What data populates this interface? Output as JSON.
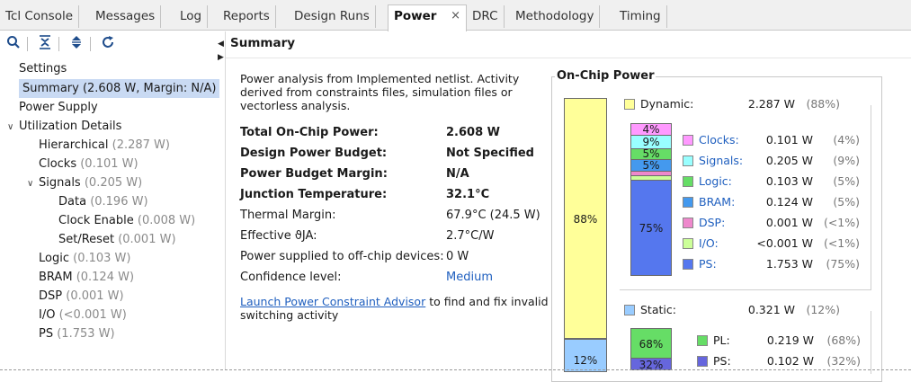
{
  "tabs": [
    {
      "label": "Tcl Console"
    },
    {
      "label": "Messages"
    },
    {
      "label": "Log"
    },
    {
      "label": "Reports"
    },
    {
      "label": "Design Runs"
    },
    {
      "label": "Power",
      "active": true
    },
    {
      "label": "DRC"
    },
    {
      "label": "Methodology"
    },
    {
      "label": "Timing"
    }
  ],
  "close_glyph": "×",
  "toolbar": {
    "icons": [
      "search-icon",
      "collapse-all-icon",
      "expand-all-icon",
      "refresh-icon"
    ]
  },
  "tree": {
    "settings": "Settings",
    "summary": "Summary (2.608 W, Margin: N/A)",
    "power_supply": "Power Supply",
    "utilization": "Utilization Details",
    "hierarchical": {
      "label": "Hierarchical",
      "value": "(2.287 W)"
    },
    "clocks": {
      "label": "Clocks",
      "value": "(0.101 W)"
    },
    "signals": {
      "label": "Signals",
      "value": "(0.205 W)"
    },
    "data": {
      "label": "Data",
      "value": "(0.196 W)"
    },
    "clock_enable": {
      "label": "Clock Enable",
      "value": "(0.008 W)"
    },
    "set_reset": {
      "label": "Set/Reset",
      "value": "(0.001 W)"
    },
    "logic": {
      "label": "Logic",
      "value": "(0.103 W)"
    },
    "bram": {
      "label": "BRAM",
      "value": "(0.124 W)"
    },
    "dsp": {
      "label": "DSP",
      "value": "(0.001 W)"
    },
    "io": {
      "label": "I/O",
      "value": "(<0.001 W)"
    },
    "ps": {
      "label": "PS",
      "value": "(1.753 W)"
    }
  },
  "summary": {
    "header": "Summary",
    "intro": "Power analysis from Implemented netlist. Activity derived from constraints files, simulation files or vectorless analysis.",
    "rows": {
      "total": {
        "k": "Total On-Chip Power:",
        "v": "2.608 W"
      },
      "budget": {
        "k": "Design Power Budget:",
        "v": "Not Specified"
      },
      "margin": {
        "k": "Power Budget Margin:",
        "v": "N/A"
      },
      "junction": {
        "k": "Junction Temperature:",
        "v": "32.1°C"
      },
      "thermal": {
        "k": "Thermal Margin:",
        "v": "67.9°C (24.5 W)"
      },
      "theta": {
        "k": "Effective ϑJA:",
        "v": "2.7°C/W"
      },
      "offchip": {
        "k": "Power supplied to off-chip devices:",
        "v": "0 W"
      },
      "confidence": {
        "k": "Confidence level:",
        "v": "Medium"
      }
    },
    "advisor_link": "Launch Power Constraint Advisor",
    "advisor_rest": " to find and fix invalid switching activity"
  },
  "on_chip": {
    "title": "On-Chip Power",
    "dynamic": {
      "label": "Dynamic:",
      "value": "2.287 W",
      "pct": "(88%)",
      "color": "#ffff99"
    },
    "static": {
      "label": "Static:",
      "value": "0.321 W",
      "pct": "(12%)",
      "color": "#99ccff"
    },
    "main_bar": {
      "dynamic_pct": 88,
      "dynamic_label": "88%",
      "static_pct": 12,
      "static_label": "12%"
    },
    "dynamic_items": [
      {
        "name": "Clocks:",
        "value": "0.101 W",
        "pct": "(4%)",
        "bar_label": "4%",
        "color": "#ff99ff",
        "link": true
      },
      {
        "name": "Signals:",
        "value": "0.205 W",
        "pct": "(9%)",
        "bar_label": "9%",
        "color": "#99ffff",
        "link": true
      },
      {
        "name": "Logic:",
        "value": "0.103 W",
        "pct": "(5%)",
        "bar_label": "5%",
        "color": "#66dd66",
        "link": true
      },
      {
        "name": "BRAM:",
        "value": "0.124 W",
        "pct": "(5%)",
        "bar_label": "5%",
        "color": "#4499ee",
        "link": true
      },
      {
        "name": "DSP:",
        "value": "0.001 W",
        "pct": "(<1%)",
        "bar_label": "",
        "color": "#ee88cc",
        "link": true
      },
      {
        "name": "I/O:",
        "value": "<0.001 W",
        "pct": "(<1%)",
        "bar_label": "",
        "color": "#ccff99",
        "link": true
      },
      {
        "name": "PS:",
        "value": "1.753 W",
        "pct": "(75%)",
        "bar_label": "75%",
        "color": "#5577ee",
        "link": true
      }
    ],
    "static_items": [
      {
        "name": "PL:",
        "value": "0.219 W",
        "pct": "(68%)",
        "bar_label": "68%",
        "color": "#66dd66"
      },
      {
        "name": "PS:",
        "value": "0.102 W",
        "pct": "(32%)",
        "bar_label": "32%",
        "color": "#6666dd"
      }
    ]
  }
}
